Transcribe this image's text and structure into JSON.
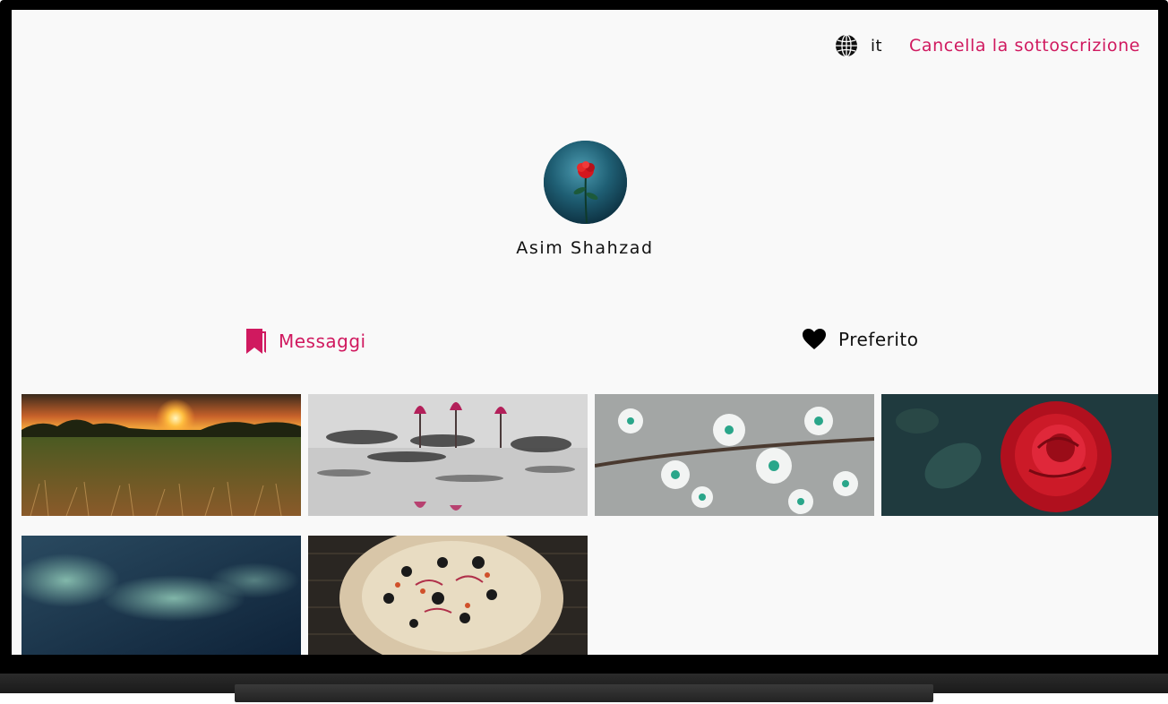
{
  "header": {
    "language_code": "it",
    "unsubscribe_label": "Cancella la sottoscrizione"
  },
  "profile": {
    "name": "Asim Shahzad"
  },
  "tabs": [
    {
      "label": "Messaggi",
      "icon": "bookmark-icon",
      "active": true
    },
    {
      "label": "Preferito",
      "icon": "heart-icon",
      "active": false
    }
  ],
  "posts": [
    {
      "subject": "sunset-field"
    },
    {
      "subject": "lotus-pond"
    },
    {
      "subject": "white-blossoms"
    },
    {
      "subject": "red-rose"
    },
    {
      "subject": "aurora-blur"
    },
    {
      "subject": "pizza"
    }
  ],
  "colors": {
    "accent": "#d0195f",
    "screen_bg": "#f9f9f9",
    "text": "#111111"
  }
}
